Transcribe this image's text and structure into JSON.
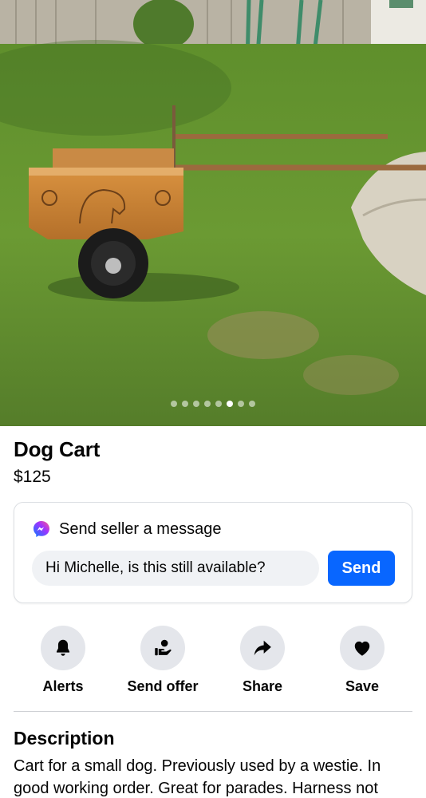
{
  "listing": {
    "title": "Dog Cart",
    "price": "$125",
    "photo": {
      "description_icon": "listing-photo",
      "carousel_count": 8,
      "carousel_active_index": 5
    }
  },
  "message": {
    "heading": "Send seller a message",
    "input_value": "Hi Michelle, is this still available?",
    "send_label": "Send",
    "icon": "messenger-icon",
    "accent": "#0866ff"
  },
  "actions": [
    {
      "label": "Alerts",
      "icon": "bell-icon"
    },
    {
      "label": "Send offer",
      "icon": "send-offer-icon"
    },
    {
      "label": "Share",
      "icon": "share-arrow-icon"
    },
    {
      "label": "Save",
      "icon": "heart-icon"
    }
  ],
  "description": {
    "heading": "Description",
    "text": "Cart for a small dog. Previously used by a westie. In good working order. Great for parades. Harness not"
  }
}
